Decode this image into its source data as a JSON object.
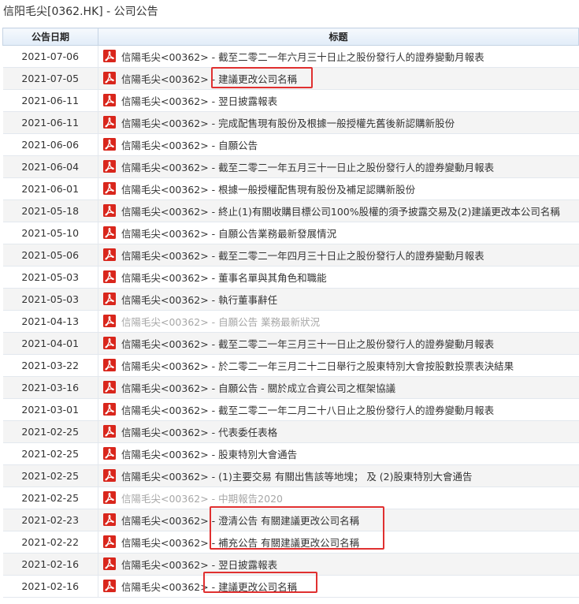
{
  "page": {
    "title": "信阳毛尖[0362.HK] - 公司公告"
  },
  "table": {
    "headers": {
      "date": "公告日期",
      "title": "标题"
    },
    "rows": [
      {
        "date": "2021-07-06",
        "title": "信陽毛尖<00362> - 截至二零二一年六月三十日止之股份發行人的證券變動月報表",
        "greyed": false
      },
      {
        "date": "2021-07-05",
        "title": "信陽毛尖<00362> - 建議更改公司名稱",
        "greyed": false
      },
      {
        "date": "2021-06-11",
        "title": "信陽毛尖<00362> - 翌日披露報表",
        "greyed": false
      },
      {
        "date": "2021-06-11",
        "title": "信陽毛尖<00362> - 完成配售現有股份及根據一般授權先舊後新認購新股份",
        "greyed": false
      },
      {
        "date": "2021-06-06",
        "title": "信陽毛尖<00362> - 自願公告",
        "greyed": false
      },
      {
        "date": "2021-06-04",
        "title": "信陽毛尖<00362> - 截至二零二一年五月三十一日止之股份發行人的證券變動月報表",
        "greyed": false
      },
      {
        "date": "2021-06-01",
        "title": "信陽毛尖<00362> - 根據一般授權配售現有股份及補足認購新股份",
        "greyed": false
      },
      {
        "date": "2021-05-18",
        "title": "信陽毛尖<00362> - 終止(1)有關收購目標公司100%股權的須予披露交易及(2)建議更改本公司名稱",
        "greyed": false
      },
      {
        "date": "2021-05-10",
        "title": "信陽毛尖<00362> - 自願公告業務最新發展情況",
        "greyed": false
      },
      {
        "date": "2021-05-06",
        "title": "信陽毛尖<00362> - 截至二零二一年四月三十日止之股份發行人的證券變動月報表",
        "greyed": false
      },
      {
        "date": "2021-05-03",
        "title": "信陽毛尖<00362> - 董事名單與其角色和職能",
        "greyed": false
      },
      {
        "date": "2021-05-03",
        "title": "信陽毛尖<00362> - 執行董事辭任",
        "greyed": false
      },
      {
        "date": "2021-04-13",
        "title": "信陽毛尖<00362> - 自願公告 業務最新狀況",
        "greyed": true
      },
      {
        "date": "2021-04-01",
        "title": "信陽毛尖<00362> - 截至二零二一年三月三十一日止之股份發行人的證券變動月報表",
        "greyed": false
      },
      {
        "date": "2021-03-22",
        "title": "信陽毛尖<00362> - 於二零二一年三月二十二日舉行之股東特別大會按股數投票表決結果",
        "greyed": false
      },
      {
        "date": "2021-03-16",
        "title": "信陽毛尖<00362> - 自願公告 - 關於成立合資公司之框架協議",
        "greyed": false
      },
      {
        "date": "2021-03-01",
        "title": "信陽毛尖<00362> - 截至二零二一年二月二十八日止之股份發行人的證券變動月報表",
        "greyed": false
      },
      {
        "date": "2021-02-25",
        "title": "信陽毛尖<00362> - 代表委任表格",
        "greyed": false
      },
      {
        "date": "2021-02-25",
        "title": "信陽毛尖<00362> - 股東特別大會通告",
        "greyed": false
      },
      {
        "date": "2021-02-25",
        "title": "信陽毛尖<00362> - (1)主要交易 有關出售該等地塊； 及 (2)股東特別大會通告",
        "greyed": false
      },
      {
        "date": "2021-02-25",
        "title": "信陽毛尖<00362> - 中期報告2020",
        "greyed": true
      },
      {
        "date": "2021-02-23",
        "title": "信陽毛尖<00362> - 澄清公告 有關建議更改公司名稱",
        "greyed": false
      },
      {
        "date": "2021-02-22",
        "title": "信陽毛尖<00362> - 補充公告 有關建議更改公司名稱",
        "greyed": false
      },
      {
        "date": "2021-02-16",
        "title": "信陽毛尖<00362> - 翌日披露報表",
        "greyed": false
      },
      {
        "date": "2021-02-16",
        "title": "信陽毛尖<00362> - 建議更改公司名稱",
        "greyed": false
      }
    ]
  },
  "pdf_icon": {
    "name": "pdf-icon",
    "color": "#d9261c"
  },
  "highlight_color": "#e03030"
}
